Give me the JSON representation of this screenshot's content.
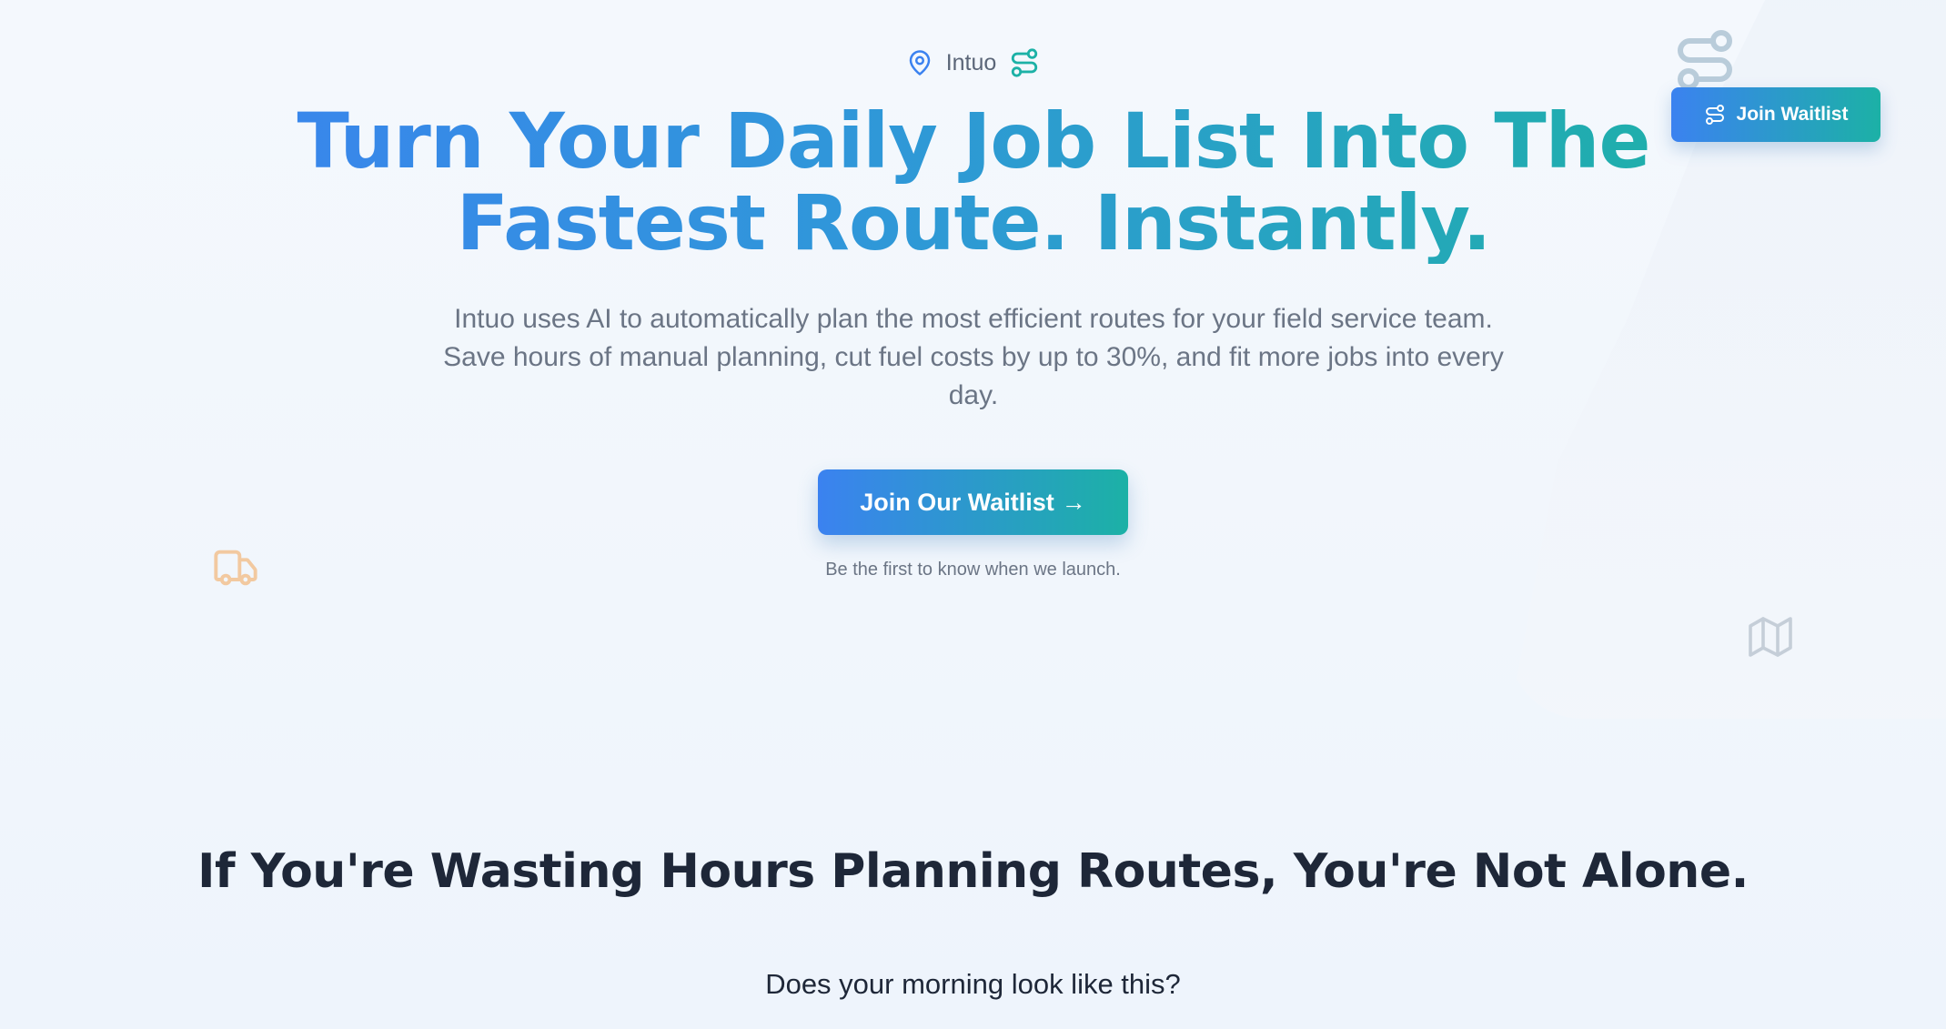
{
  "brand": {
    "name": "Intuo",
    "icons": [
      "map-pin-icon",
      "route-icon"
    ]
  },
  "nav": {
    "join_label": "Join Waitlist",
    "join_icon": "route-icon"
  },
  "hero": {
    "headline": "Turn Your Daily Job List Into The Fastest Route. Instantly.",
    "subtitle": "Intuo uses AI to automatically plan the most efficient routes for your field service team. Save hours of manual planning, cut fuel costs by up to 30%, and fit more jobs into every day.",
    "cta_label": "Join Our Waitlist",
    "cta_arrow": "→",
    "cta_note": "Be the first to know when we launch."
  },
  "decor": {
    "icons": [
      "truck-icon",
      "map-icon",
      "route-icon"
    ]
  },
  "problem": {
    "title": "If You're Wasting Hours Planning Routes, You're Not Alone.",
    "question": "Does your morning look like this?"
  },
  "colors": {
    "gradient_start": "#3b82f0",
    "gradient_end": "#1cb1a6",
    "text_dark": "#1e2738",
    "text_muted": "#6b7585",
    "truck_icon": "#f2c9a0",
    "decor_gray": "#c5ced8"
  }
}
